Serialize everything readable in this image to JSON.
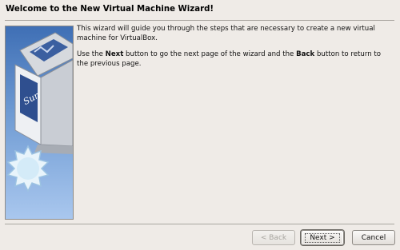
{
  "wizard": {
    "title": "Welcome to the New Virtual Machine Wizard!",
    "intro_text": "This wizard will guide you through the steps that are necessary to create a new virtual machine for VirtualBox.",
    "nav_use": "Use the ",
    "nav_next_word": "Next",
    "nav_middle": " button to go the next page of the wizard and the ",
    "nav_back_word": "Back",
    "nav_end": " button to return to the previous page.",
    "logo_text": "Sun"
  },
  "buttons": {
    "back_label": "< Back",
    "next_label": "Next >",
    "cancel_label": "Cancel"
  }
}
